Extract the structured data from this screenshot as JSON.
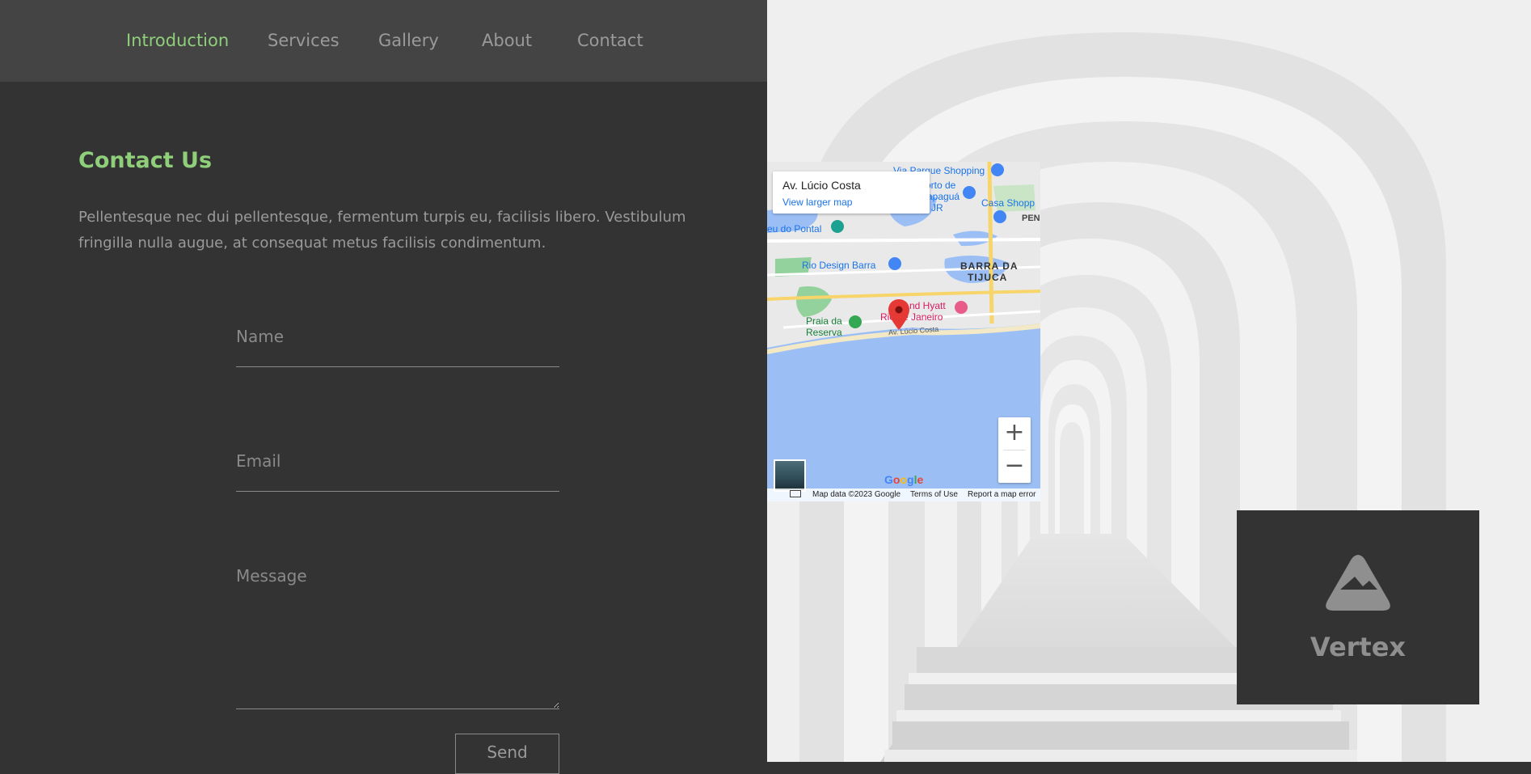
{
  "nav": {
    "items": [
      {
        "label": "Introduction",
        "active": true
      },
      {
        "label": "Services",
        "active": false
      },
      {
        "label": "Gallery",
        "active": false
      },
      {
        "label": "About",
        "active": false
      },
      {
        "label": "Contact",
        "active": false
      }
    ]
  },
  "contact": {
    "heading": "Contact Us",
    "description": "Pellentesque nec dui pellentesque, fermentum turpis eu, facilisis libero. Vestibulum fringilla nulla augue, at consequat metus facilisis condimentum.",
    "name_placeholder": "Name",
    "email_placeholder": "Email",
    "message_placeholder": "Message",
    "send_label": "Send"
  },
  "map": {
    "place_name": "Av. Lúcio Costa",
    "view_larger_label": "View larger map",
    "zoom_in_label": "+",
    "zoom_out_label": "−",
    "google_logo": "Google",
    "attribution": {
      "map_data": "Map data ©2023 Google",
      "terms": "Terms of Use",
      "report": "Report a map error"
    },
    "labels": {
      "via_parque": "Via Parque Shopping",
      "porto": "orto de",
      "pagua": "apaguá",
      "jr": "JR",
      "casa_shopping": "Casa Shopp",
      "pen": "PEN",
      "pontal": "eu do Pontal",
      "rio_design": "Rio Design Barra",
      "barra": "BARRA DA",
      "tijuca": "TIJUCA",
      "hyatt1": "nd Hyatt",
      "hyatt2": "Rio de Janeiro",
      "praia1": "Praia da",
      "praia2": "Reserva",
      "street": "Av. Lúcio Costa"
    },
    "colors": {
      "water": "#9bbff5",
      "land": "#e9e9ea",
      "park": "#94d29d",
      "road": "#f7d56a",
      "pin": "#e53935"
    }
  },
  "brand": {
    "name": "Vertex",
    "icon": "triangle-logo-icon"
  },
  "colors": {
    "accent": "#8fcf7a",
    "panel": "#333333",
    "nav_bg": "#444444",
    "muted_text": "#9a9a9a"
  }
}
